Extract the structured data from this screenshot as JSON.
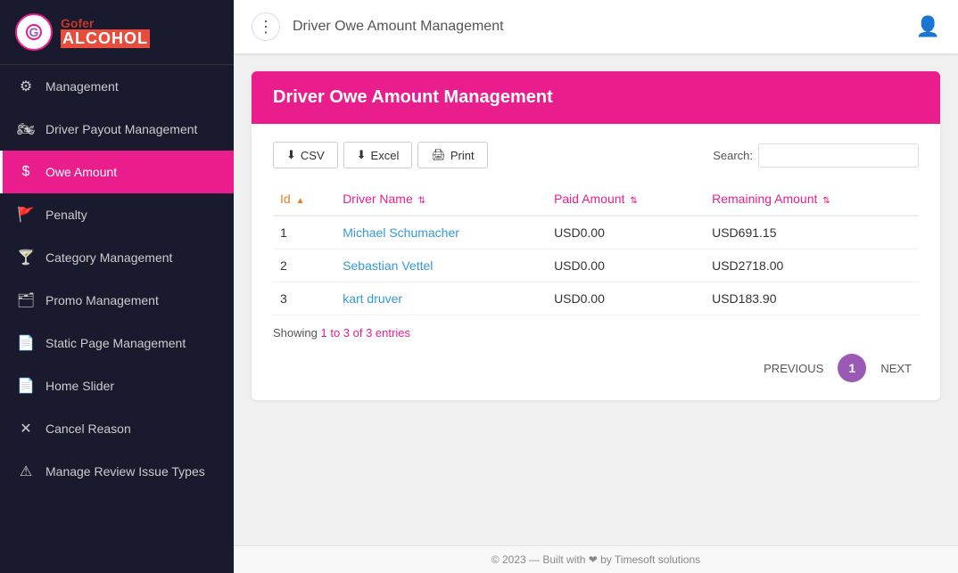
{
  "brand": {
    "name_gofer": "Gofer",
    "name_alcohol": "ALCOHOL",
    "logo_letter": "G"
  },
  "topbar": {
    "title": "Driver Owe Amount Management",
    "dots_icon": "⋮",
    "user_icon": "👤"
  },
  "sidebar": {
    "items": [
      {
        "id": "management",
        "label": "Management",
        "icon": "⚙",
        "active": false,
        "partial": true
      },
      {
        "id": "driver-payout",
        "label": "Driver Payout Management",
        "icon": "🏍",
        "active": false
      },
      {
        "id": "owe-amount",
        "label": "Owe Amount",
        "icon": "$",
        "active": true
      },
      {
        "id": "penalty",
        "label": "Penalty",
        "icon": "🚩",
        "active": false
      },
      {
        "id": "category",
        "label": "Category Management",
        "icon": "🍸",
        "active": false
      },
      {
        "id": "promo",
        "label": "Promo Management",
        "icon": "🗂",
        "active": false
      },
      {
        "id": "static-page",
        "label": "Static Page Management",
        "icon": "📄",
        "active": false
      },
      {
        "id": "home-slider",
        "label": "Home Slider",
        "icon": "📄",
        "active": false
      },
      {
        "id": "cancel-reason",
        "label": "Cancel Reason",
        "icon": "✕",
        "active": false
      },
      {
        "id": "review-issue",
        "label": "Manage Review Issue Types",
        "icon": "⚠",
        "active": false
      }
    ]
  },
  "page": {
    "card_title": "Driver Owe Amount Management",
    "toolbar": {
      "csv_label": "CSV",
      "excel_label": "Excel",
      "print_label": "Print",
      "search_label": "Search:",
      "search_placeholder": ""
    },
    "table": {
      "columns": [
        {
          "id": "id",
          "label": "Id",
          "sort": "asc"
        },
        {
          "id": "driver_name",
          "label": "Driver Name",
          "sort": "both"
        },
        {
          "id": "paid_amount",
          "label": "Paid Amount",
          "sort": "both"
        },
        {
          "id": "remaining_amount",
          "label": "Remaining Amount",
          "sort": "both"
        }
      ],
      "rows": [
        {
          "id": "1",
          "driver_name": "Michael Schumacher",
          "paid_amount": "USD0.00",
          "remaining_amount": "USD691.15"
        },
        {
          "id": "2",
          "driver_name": "Sebastian Vettel",
          "paid_amount": "USD0.00",
          "remaining_amount": "USD2718.00"
        },
        {
          "id": "3",
          "driver_name": "kart druver",
          "paid_amount": "USD0.00",
          "remaining_amount": "USD183.90"
        }
      ]
    },
    "showing_text": "Showing",
    "showing_range": "1 to 3",
    "showing_total": "of 3 entries",
    "pagination": {
      "prev_label": "PREVIOUS",
      "next_label": "NEXT",
      "current_page": "1"
    }
  },
  "footer": {
    "text": "© 2023 — Built with ❤ by Timesoft solutions"
  }
}
